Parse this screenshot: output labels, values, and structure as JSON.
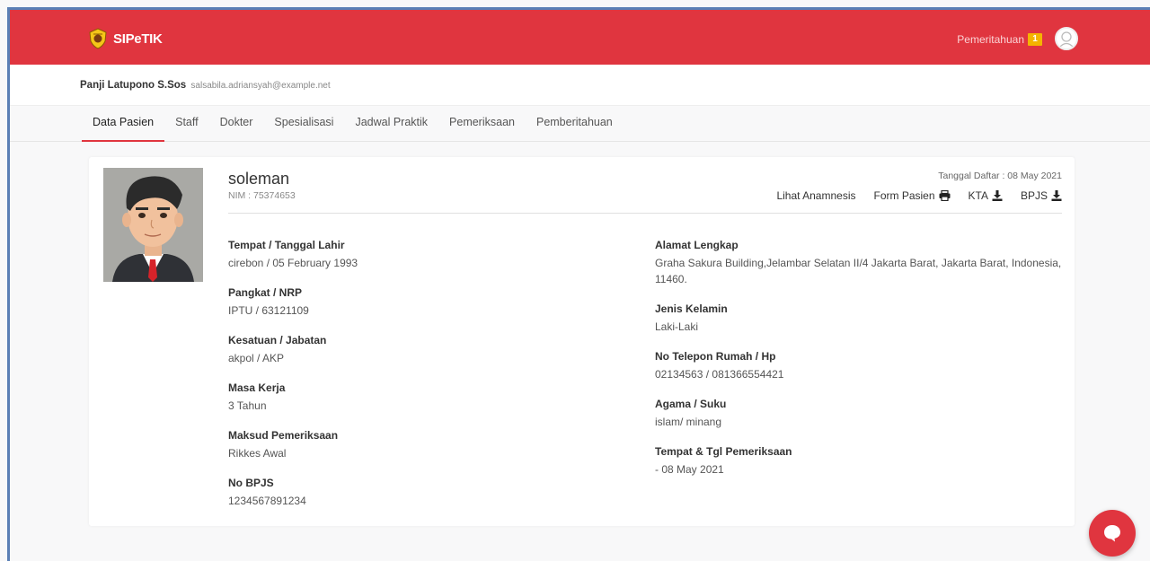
{
  "app": {
    "name": "SIPeTIK"
  },
  "header": {
    "notification_label": "Pemeritahuan",
    "notification_count": "1"
  },
  "user": {
    "name": "Panji Latupono S.Sos",
    "email": "salsabila.adriansyah@example.net"
  },
  "tabs": [
    {
      "label": "Data Pasien",
      "active": true
    },
    {
      "label": "Staff"
    },
    {
      "label": "Dokter"
    },
    {
      "label": "Spesialisasi"
    },
    {
      "label": "Jadwal Praktik"
    },
    {
      "label": "Pemeriksaan"
    },
    {
      "label": "Pemberitahuan"
    }
  ],
  "patient": {
    "name": "soleman",
    "nim": "NIM : 75374653",
    "registered": "Tanggal Daftar : 08 May 2021"
  },
  "actions": {
    "anamnesis": "Lihat Anamnesis",
    "form": "Form Pasien",
    "kta": "KTA",
    "bpjs": "BPJS"
  },
  "fields_left": [
    {
      "label": "Tempat / Tanggal Lahir",
      "value": "cirebon / 05 February 1993"
    },
    {
      "label": "Pangkat / NRP",
      "value": "IPTU / 63121109"
    },
    {
      "label": "Kesatuan / Jabatan",
      "value": "akpol / AKP"
    },
    {
      "label": "Masa Kerja",
      "value": "3 Tahun"
    },
    {
      "label": "Maksud Pemeriksaan",
      "value": "Rikkes Awal"
    },
    {
      "label": "No BPJS",
      "value": "1234567891234"
    }
  ],
  "fields_right": [
    {
      "label": "Alamat Lengkap",
      "value": "Graha Sakura Building,Jelambar Selatan II/4 Jakarta Barat, Jakarta Barat, Indonesia, 11460."
    },
    {
      "label": "Jenis Kelamin",
      "value": "Laki-Laki"
    },
    {
      "label": "No Telepon Rumah / Hp",
      "value": "02134563 / 081366554421"
    },
    {
      "label": "Agama / Suku",
      "value": "islam/ minang"
    },
    {
      "label": "Tempat & Tgl Pemeriksaan",
      "value": "- 08 May 2021"
    }
  ],
  "colors": {
    "primary": "#e0353f",
    "badge": "#f4b400"
  },
  "icons": {
    "logo": "police-emblem-icon",
    "form": "printer-icon",
    "kta": "download-icon",
    "bpjs": "download-icon",
    "chat": "chat-bubble-icon",
    "avatar": "user-avatar-icon"
  }
}
